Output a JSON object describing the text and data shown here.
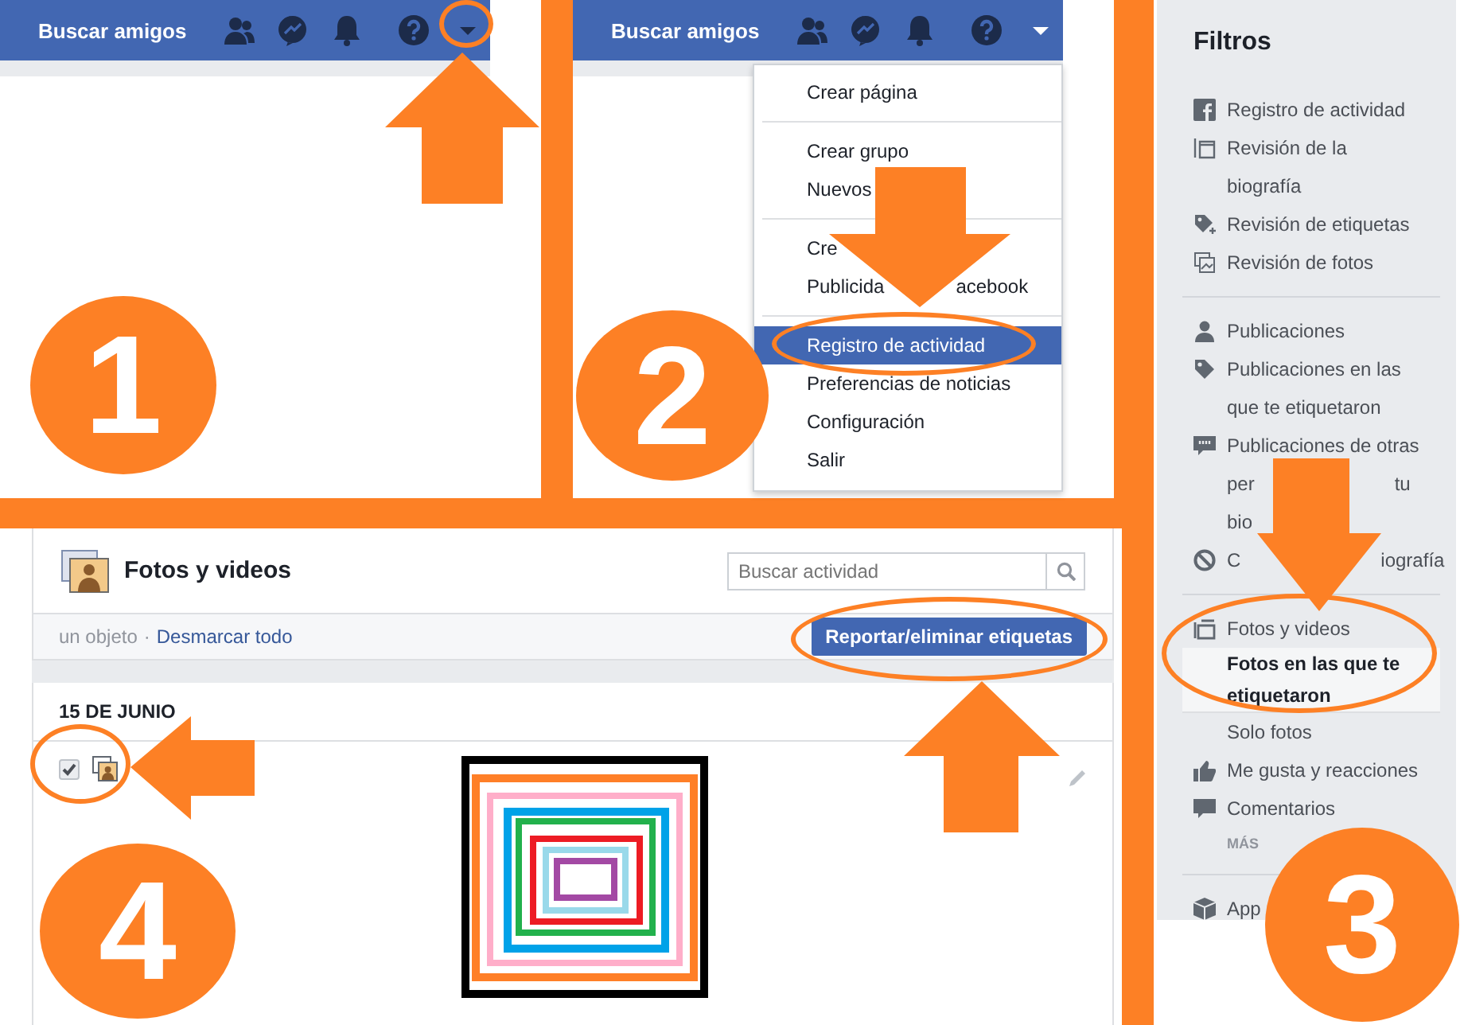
{
  "panel_1": {
    "step": "1",
    "navbar": {
      "find_friends": "Buscar amigos",
      "menu_open": false
    }
  },
  "panel_2": {
    "step": "2",
    "navbar": {
      "find_friends": "Buscar amigos",
      "menu_open": true
    },
    "menu": [
      [
        {
          "parts": [
            "Crear página"
          ],
          "selected": false
        }
      ],
      [
        {
          "parts": [
            "Crear grupo"
          ],
          "selected": false
        },
        {
          "parts": [
            "Nuevos"
          ],
          "selected": false
        }
      ],
      [
        {
          "parts": [
            "Cre"
          ],
          "selected": false
        },
        {
          "parts": [
            "Publicida",
            "acebook"
          ],
          "selected": false
        }
      ],
      [
        {
          "parts": [
            "Registro de actividad"
          ],
          "selected": true
        },
        {
          "parts": [
            "Preferencias de noticias"
          ],
          "selected": false
        },
        {
          "parts": [
            "Configuración"
          ],
          "selected": false
        },
        {
          "parts": [
            "Salir"
          ],
          "selected": false
        }
      ]
    ]
  },
  "panel_3": {
    "step": "3",
    "title": "Filtros",
    "groups": [
      [
        {
          "kind": "filter",
          "text": "Registro de actividad",
          "selected": false
        },
        {
          "kind": "filter",
          "text": "Revisión de la biografía",
          "selected": false
        },
        {
          "kind": "filter",
          "text": "Revisión de etiquetas",
          "selected": false
        },
        {
          "kind": "filter",
          "text": "Revisión de fotos",
          "selected": false
        }
      ],
      [
        {
          "kind": "filter",
          "text": "Publicaciones",
          "selected": false
        },
        {
          "kind": "filter",
          "text": "Publicaciones en las que te etiquetaron",
          "selected": false
        },
        {
          "kind": "filter",
          "lines": [
            [
              "Publicaciones de otras"
            ],
            [
              "per",
              "tu"
            ],
            [
              "bio"
            ]
          ],
          "selected": false
        },
        {
          "kind": "filter",
          "lines": [
            [
              "C",
              "iografía"
            ]
          ],
          "selected": false
        }
      ],
      [
        {
          "kind": "filter",
          "text": "Fotos y videos",
          "selected": false
        },
        {
          "kind": "sub",
          "text": "Fotos en las que te etiquetaron",
          "selected": true
        },
        {
          "kind": "sub",
          "text": "Solo fotos",
          "selected": false
        },
        {
          "kind": "filter",
          "text": "Me gusta y reacciones",
          "selected": false
        },
        {
          "kind": "filter",
          "text": "Comentarios",
          "selected": false
        },
        {
          "kind": "more",
          "text": "MÁS"
        }
      ],
      [
        {
          "kind": "filter",
          "text": "App",
          "selected": false
        }
      ]
    ]
  },
  "panel_4": {
    "step": "4",
    "title": "Fotos y videos",
    "search": {
      "placeholder": "Buscar actividad"
    },
    "selection_count": "un objeto",
    "separator": "·",
    "unselect_all": "Desmarcar todo",
    "report_button": "Reportar/eliminar etiquetas",
    "date": "15 DE JUNIO",
    "entries": [
      {
        "checked": true,
        "kind": "picture"
      }
    ]
  }
}
